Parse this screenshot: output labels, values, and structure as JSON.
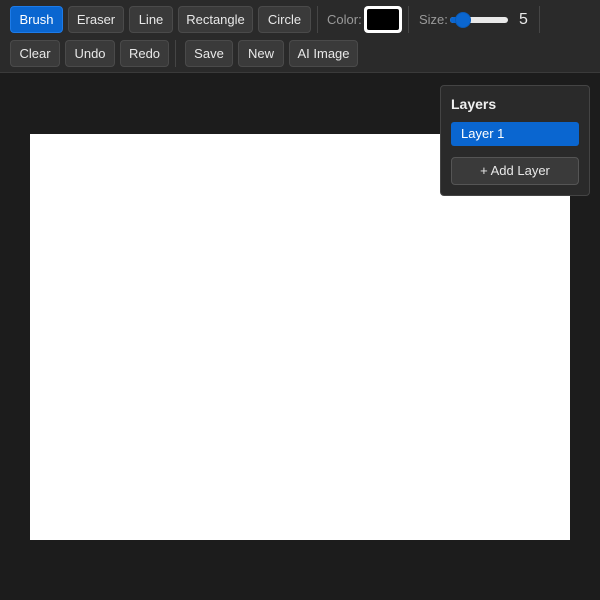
{
  "toolbar": {
    "tools": {
      "brush": "Brush",
      "eraser": "Eraser",
      "line": "Line",
      "rectangle": "Rectangle",
      "circle": "Circle"
    },
    "active_tool": "Brush",
    "color_label": "Color:",
    "current_color": "#000000",
    "size_label": "Size:",
    "size_value": "5",
    "size_slider_fraction": 0.12,
    "actions": {
      "clear": "Clear",
      "undo": "Undo",
      "redo": "Redo",
      "save": "Save",
      "new": "New",
      "ai_image": "AI Image"
    }
  },
  "layers": {
    "title": "Layers",
    "items": [
      {
        "label": "Layer 1",
        "selected": true
      }
    ],
    "add_label": "+ Add Layer"
  },
  "colors": {
    "accent": "#0a66d0",
    "background": "#1c1c1c",
    "toolbar": "#2a2a2a",
    "canvas": "#ffffff"
  }
}
